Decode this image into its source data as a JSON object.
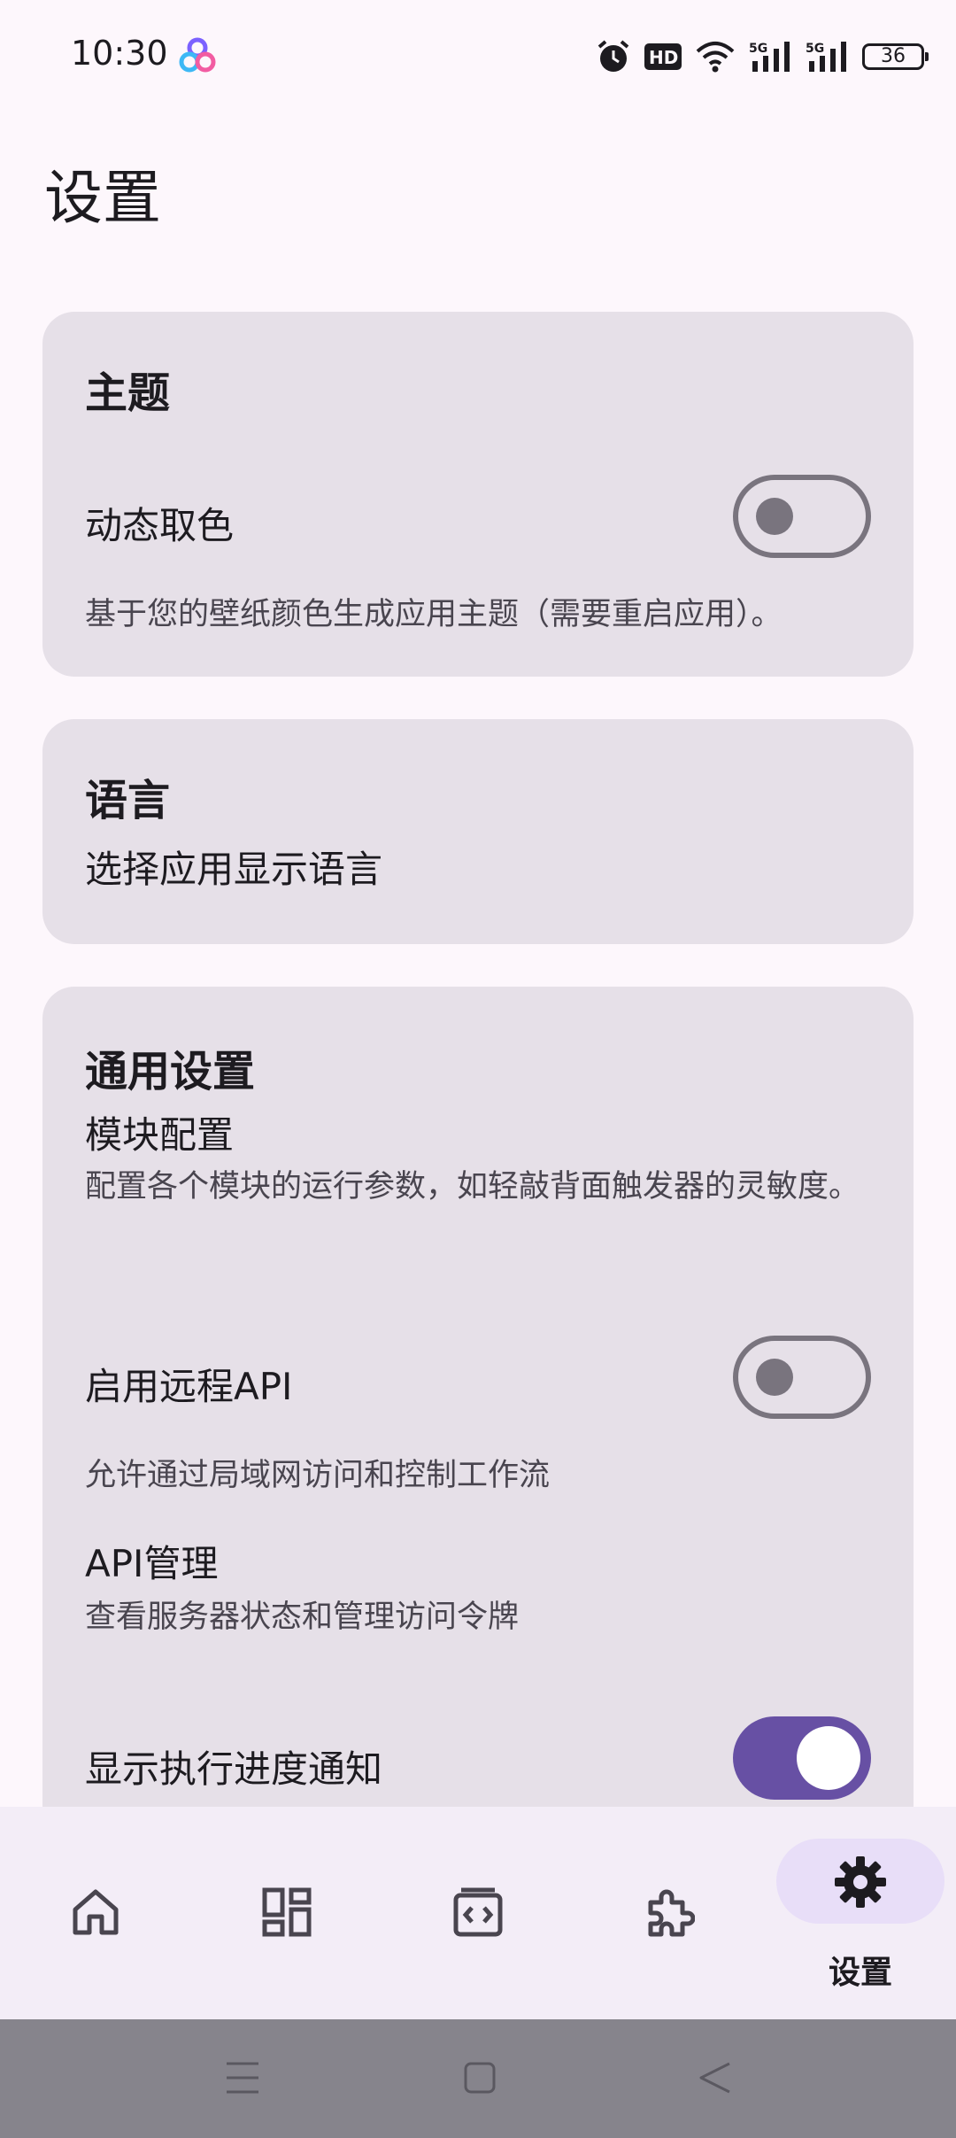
{
  "status_bar": {
    "time": "10:30",
    "battery": "36",
    "icons": [
      "alarm-icon",
      "hd-icon",
      "wifi-icon",
      "5g-signal-icon",
      "5g-signal-icon",
      "battery-icon"
    ]
  },
  "page": {
    "title": "设置"
  },
  "theme_card": {
    "title": "主题",
    "dynamic_color_label": "动态取色",
    "dynamic_color_enabled": false,
    "dynamic_color_desc": "基于您的壁纸颜色生成应用主题（需要重启应用）。"
  },
  "language_card": {
    "title": "语言",
    "subtitle": "选择应用显示语言"
  },
  "general_card": {
    "title": "通用设置",
    "module_config_label": "模块配置",
    "module_config_desc": "配置各个模块的运行参数，如轻敲背面触发器的灵敏度。",
    "remote_api_label": "启用远程API",
    "remote_api_enabled": false,
    "remote_api_desc": "允许通过局域网访问和控制工作流",
    "api_manage_label": "API管理",
    "api_manage_desc": "查看服务器状态和管理访问令牌",
    "progress_notify_label": "显示执行进度通知",
    "progress_notify_enabled": true
  },
  "bottom_nav": {
    "items": [
      {
        "icon": "home-icon",
        "label": ""
      },
      {
        "icon": "dashboard-icon",
        "label": ""
      },
      {
        "icon": "code-box-icon",
        "label": ""
      },
      {
        "icon": "puzzle-icon",
        "label": ""
      },
      {
        "icon": "gear-icon",
        "label": "设置",
        "active": true
      }
    ]
  },
  "colors": {
    "background": "#FDF7FC",
    "card": "#E6E0E8",
    "accent": "#6750A4",
    "active_pill": "#E8DEF8"
  }
}
